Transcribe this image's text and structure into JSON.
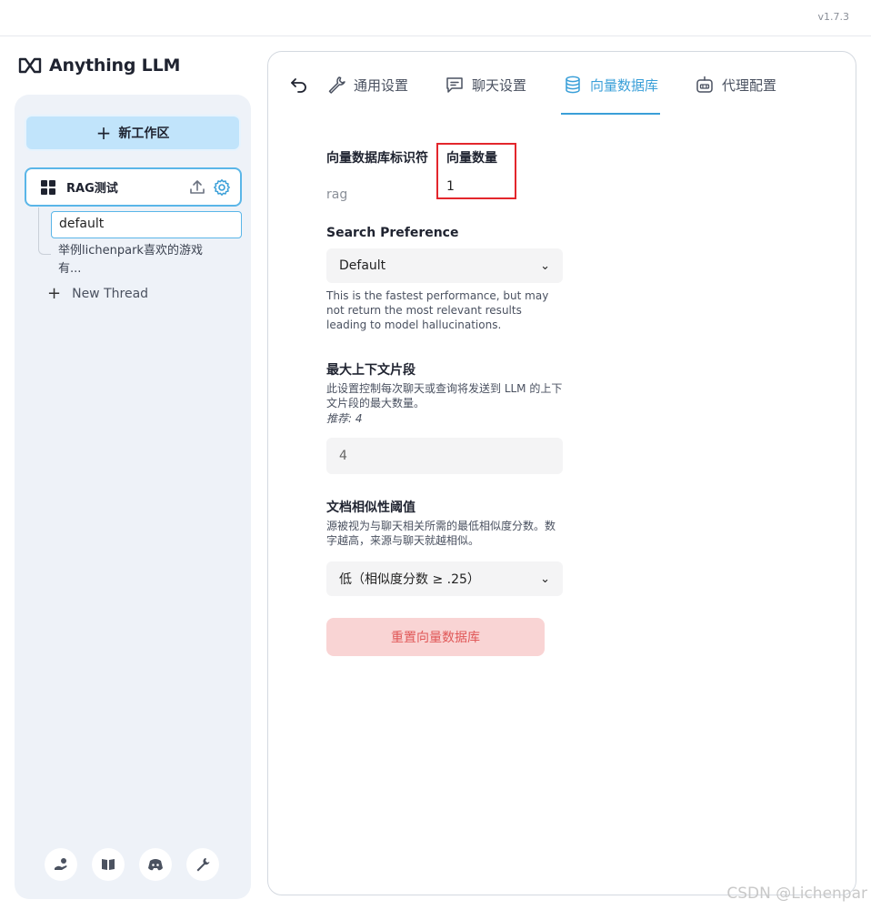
{
  "app": {
    "version": "v1.7.3",
    "logo_text": "Anything LLM"
  },
  "sidebar": {
    "new_workspace_label": "新工作区",
    "workspace": {
      "name": "RAG测试"
    },
    "threads": [
      {
        "label": "default"
      },
      {
        "label": "举例lichenpark喜欢的游戏有..."
      }
    ],
    "new_thread_label": "New Thread",
    "footer_icons": [
      "community-hub-icon",
      "docs-book-icon",
      "discord-icon",
      "settings-wrench-icon"
    ]
  },
  "tabs": [
    {
      "label": "通用设置",
      "icon": "wrench-icon",
      "active": false
    },
    {
      "label": "聊天设置",
      "icon": "chat-icon",
      "active": false
    },
    {
      "label": "向量数据库",
      "icon": "database-icon",
      "active": true
    },
    {
      "label": "代理配置",
      "icon": "robot-icon",
      "active": false
    }
  ],
  "vector_db": {
    "identifier_label": "向量数据库标识符",
    "identifier_value": "rag",
    "count_label": "向量数量",
    "count_value": "1",
    "search_pref_label": "Search Preference",
    "search_pref_value": "Default",
    "search_pref_help": "This is the fastest performance, but may not return the most relevant results leading to model hallucinations.",
    "max_context_label": "最大上下文片段",
    "max_context_help": "此设置控制每次聊天或查询将发送到 LLM 的上下文片段的最大数量。",
    "max_context_recommend": "推荐: 4",
    "max_context_value": "4",
    "threshold_label": "文档相似性阈值",
    "threshold_help": "源被视为与聊天相关所需的最低相似度分数。数字越高，来源与聊天就越相似。",
    "threshold_value": "低（相似度分数 ≥ .25）",
    "reset_label": "重置向量数据库"
  },
  "watermark": "CSDN @Lichenpar",
  "colors": {
    "accent": "#3a9fd8",
    "highlight_box": "#e3262c",
    "danger_bg": "#f9d4d4",
    "danger_text": "#e05757",
    "sidebar_bg": "#eef2f8"
  }
}
